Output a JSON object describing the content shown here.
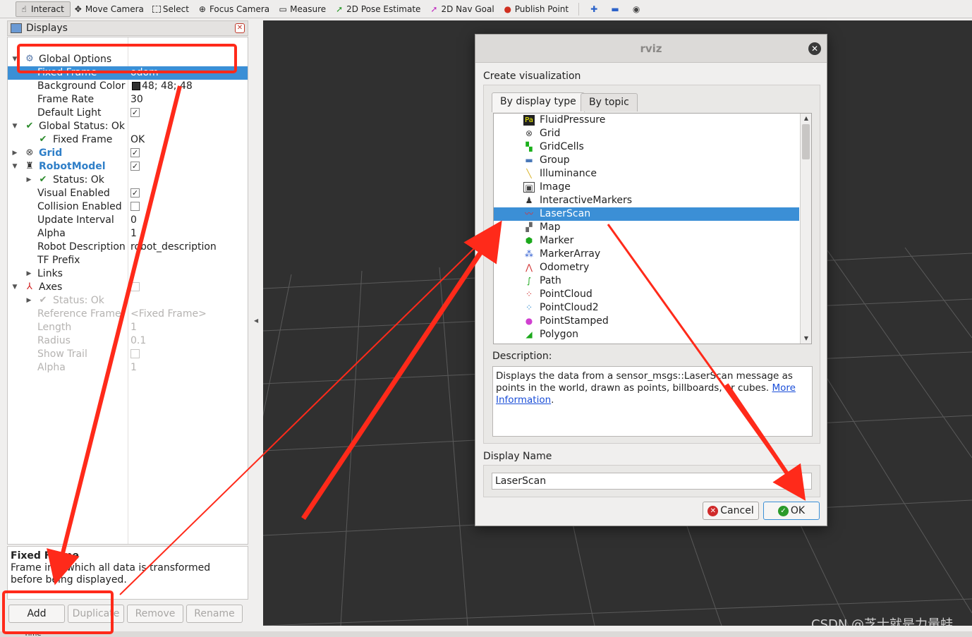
{
  "toolbar": {
    "tools": [
      "Interact",
      "Move Camera",
      "Select",
      "Focus Camera",
      "Measure",
      "2D Pose Estimate",
      "2D Nav Goal",
      "Publish Point"
    ]
  },
  "displays": {
    "title": "Displays",
    "rows": [
      {
        "label": "Global Options",
        "value": ""
      },
      {
        "label": "Fixed Frame",
        "value": "odom"
      },
      {
        "label": "Background Color",
        "value": "48; 48; 48"
      },
      {
        "label": "Frame Rate",
        "value": "30"
      },
      {
        "label": "Default Light",
        "value": ""
      },
      {
        "label": "Global Status: Ok",
        "value": ""
      },
      {
        "label": "Fixed Frame",
        "value": "OK"
      },
      {
        "label": "Grid",
        "value": ""
      },
      {
        "label": "RobotModel",
        "value": ""
      },
      {
        "label": "Status: Ok",
        "value": ""
      },
      {
        "label": "Visual Enabled",
        "value": ""
      },
      {
        "label": "Collision Enabled",
        "value": ""
      },
      {
        "label": "Update Interval",
        "value": "0"
      },
      {
        "label": "Alpha",
        "value": "1"
      },
      {
        "label": "Robot Description",
        "value": "robot_description"
      },
      {
        "label": "TF Prefix",
        "value": ""
      },
      {
        "label": "Links",
        "value": ""
      },
      {
        "label": "Axes",
        "value": ""
      },
      {
        "label": "Status: Ok",
        "value": ""
      },
      {
        "label": "Reference Frame",
        "value": "<Fixed Frame>"
      },
      {
        "label": "Length",
        "value": "1"
      },
      {
        "label": "Radius",
        "value": "0.1"
      },
      {
        "label": "Show Trail",
        "value": ""
      },
      {
        "label": "Alpha",
        "value": "1"
      }
    ],
    "help_title": "Fixed Frame",
    "help_text": "Frame into which all data is transformed before being displayed.",
    "buttons": {
      "add": "Add",
      "duplicate": "Duplicate",
      "remove": "Remove",
      "rename": "Rename"
    },
    "time_label": "Time"
  },
  "dialog": {
    "title": "rviz",
    "heading": "Create visualization",
    "tabs": {
      "by_display_type": "By display type",
      "by_topic": "By topic"
    },
    "items": [
      "FluidPressure",
      "Grid",
      "GridCells",
      "Group",
      "Illuminance",
      "Image",
      "InteractiveMarkers",
      "LaserScan",
      "Map",
      "Marker",
      "MarkerArray",
      "Odometry",
      "Path",
      "PointCloud",
      "PointCloud2",
      "PointStamped",
      "Polygon"
    ],
    "selected_item": "LaserScan",
    "description_label": "Description:",
    "description_text": "Displays the data from a sensor_msgs::LaserScan message as points in the world, drawn as points, billboards, or cubes.",
    "more_link": "More",
    "info_link": "Information",
    "period": ".",
    "display_name_label": "Display Name",
    "display_name_value": "LaserScan",
    "cancel_label": "Cancel",
    "ok_label": "OK"
  },
  "watermark": "CSDN @芝士就是力量蛙",
  "colors": {
    "selection": "#3b8fd6",
    "annotation": "#ff2a1a",
    "viewport": "#303030"
  }
}
